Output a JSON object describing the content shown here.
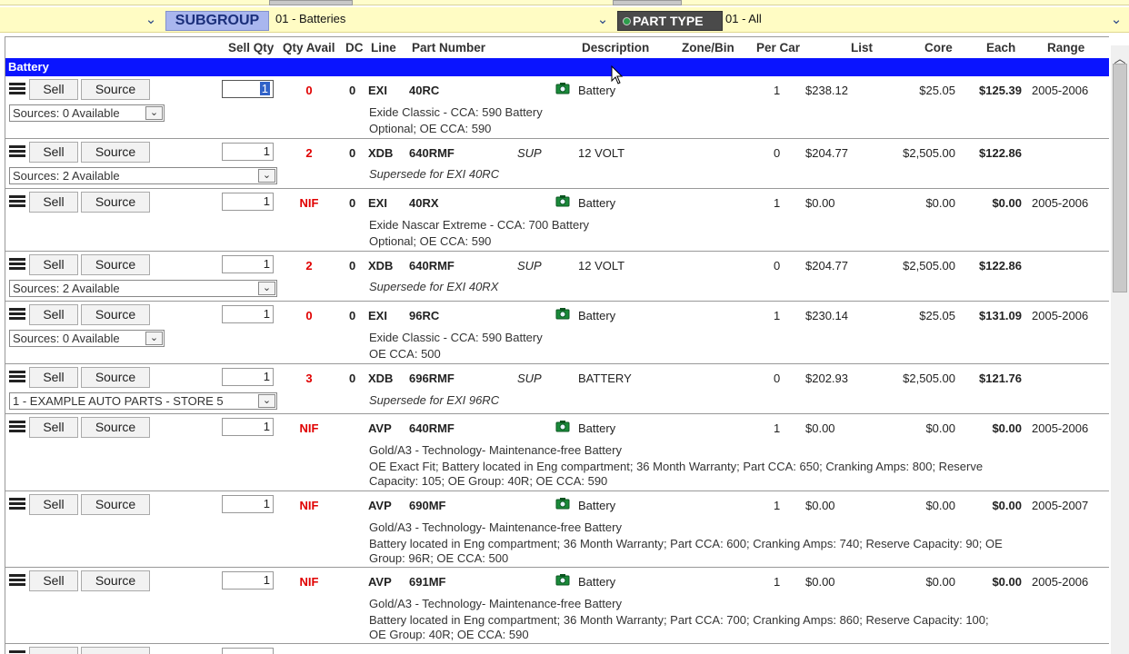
{
  "filters": {
    "subgroup_label": "SUBGROUP",
    "subgroup_value": "01 - Batteries",
    "parttype_label": "PART TYPE",
    "parttype_value": "01 - All"
  },
  "columns": {
    "sell_qty": "Sell Qty",
    "qty_avail": "Qty Avail",
    "dc": "DC",
    "line": "Line",
    "part_number": "Part Number",
    "description": "Description",
    "zone_bin": "Zone/Bin",
    "per_car": "Per Car",
    "list": "List",
    "core": "Core",
    "each": "Each",
    "range": "Range"
  },
  "group_title": "Battery",
  "buttons": {
    "sell": "Sell",
    "source": "Source"
  },
  "rows": [
    {
      "qty": "1",
      "avail": "0",
      "dc": "0",
      "line": "EXI",
      "part": "40RC",
      "sup": "",
      "desc": "Battery",
      "percar": "1",
      "list": "$238.12",
      "core": "$25.05",
      "each": "$125.39",
      "range": "2005-2006",
      "source_select": "Sources: 0 Available",
      "notes": [
        "Exide Classic - CCA: 590 Battery",
        "Optional; OE CCA: 590"
      ]
    },
    {
      "qty": "1",
      "avail": "2",
      "dc": "0",
      "line": "XDB",
      "part": "640RMF",
      "sup": "SUP",
      "desc": "12 VOLT",
      "percar": "0",
      "list": "$204.77",
      "core": "$2,505.00",
      "each": "$122.86",
      "range": "",
      "source_select": "Sources: 2 Available",
      "notes": [
        "Supersede for EXI 40RC"
      ]
    },
    {
      "qty": "1",
      "avail": "NIF",
      "dc": "0",
      "line": "EXI",
      "part": "40RX",
      "sup": "",
      "desc": "Battery",
      "percar": "1",
      "list": "$0.00",
      "core": "$0.00",
      "each": "$0.00",
      "range": "2005-2006",
      "source_select": "",
      "notes": [
        "Exide Nascar Extreme - CCA: 700 Battery",
        "Optional; OE CCA: 590"
      ]
    },
    {
      "qty": "1",
      "avail": "2",
      "dc": "0",
      "line": "XDB",
      "part": "640RMF",
      "sup": "SUP",
      "desc": "12 VOLT",
      "percar": "0",
      "list": "$204.77",
      "core": "$2,505.00",
      "each": "$122.86",
      "range": "",
      "source_select": "Sources: 2 Available",
      "notes": [
        "Supersede for EXI 40RX"
      ]
    },
    {
      "qty": "1",
      "avail": "0",
      "dc": "0",
      "line": "EXI",
      "part": "96RC",
      "sup": "",
      "desc": "Battery",
      "percar": "1",
      "list": "$230.14",
      "core": "$25.05",
      "each": "$131.09",
      "range": "2005-2006",
      "source_select": "Sources: 0 Available",
      "notes": [
        "Exide Classic - CCA: 590 Battery",
        "OE CCA: 500"
      ]
    },
    {
      "qty": "1",
      "avail": "3",
      "dc": "0",
      "line": "XDB",
      "part": "696RMF",
      "sup": "SUP",
      "desc": "BATTERY",
      "percar": "0",
      "list": "$202.93",
      "core": "$2,505.00",
      "each": "$121.76",
      "range": "",
      "source_select": "1 - EXAMPLE AUTO PARTS - STORE 5",
      "notes": [
        "Supersede for EXI 96RC"
      ]
    },
    {
      "qty": "1",
      "avail": "NIF",
      "dc": "",
      "line": "AVP",
      "part": "640RMF",
      "sup": "",
      "desc": "Battery",
      "percar": "1",
      "list": "$0.00",
      "core": "$0.00",
      "each": "$0.00",
      "range": "2005-2006",
      "source_select": "",
      "notes": [
        "Gold/A3 - Technology- Maintenance-free Battery",
        "OE Exact Fit; Battery located in Eng compartment; 36 Month Warranty; Part CCA: 650; Cranking Amps: 800; Reserve",
        "Capacity: 105; OE Group: 40R; OE CCA: 590"
      ]
    },
    {
      "qty": "1",
      "avail": "NIF",
      "dc": "",
      "line": "AVP",
      "part": "690MF",
      "sup": "",
      "desc": "Battery",
      "percar": "1",
      "list": "$0.00",
      "core": "$0.00",
      "each": "$0.00",
      "range": "2005-2007",
      "source_select": "",
      "notes": [
        "Gold/A3 - Technology- Maintenance-free Battery",
        "Battery located in Eng compartment; 36 Month Warranty; Part CCA: 600; Cranking Amps: 740; Reserve Capacity: 90; OE",
        "Group: 96R; OE CCA: 500"
      ]
    },
    {
      "qty": "1",
      "avail": "NIF",
      "dc": "",
      "line": "AVP",
      "part": "691MF",
      "sup": "",
      "desc": "Battery",
      "percar": "1",
      "list": "$0.00",
      "core": "$0.00",
      "each": "$0.00",
      "range": "2005-2006",
      "source_select": "",
      "notes": [
        "Gold/A3 - Technology- Maintenance-free Battery",
        "Battery located in Eng compartment; 36 Month Warranty; Part CCA: 700; Cranking Amps: 860; Reserve Capacity: 100;",
        "OE Group: 40R; OE CCA: 590"
      ]
    }
  ],
  "icons": {
    "menu": "hamburger-menu-icon",
    "camera": "camera-icon",
    "dropdown": "chevron-down-icon"
  },
  "colors": {
    "group_bar": "#0a14ff",
    "availability_red": "#e00000",
    "filter_bg": "#fffcc4"
  }
}
